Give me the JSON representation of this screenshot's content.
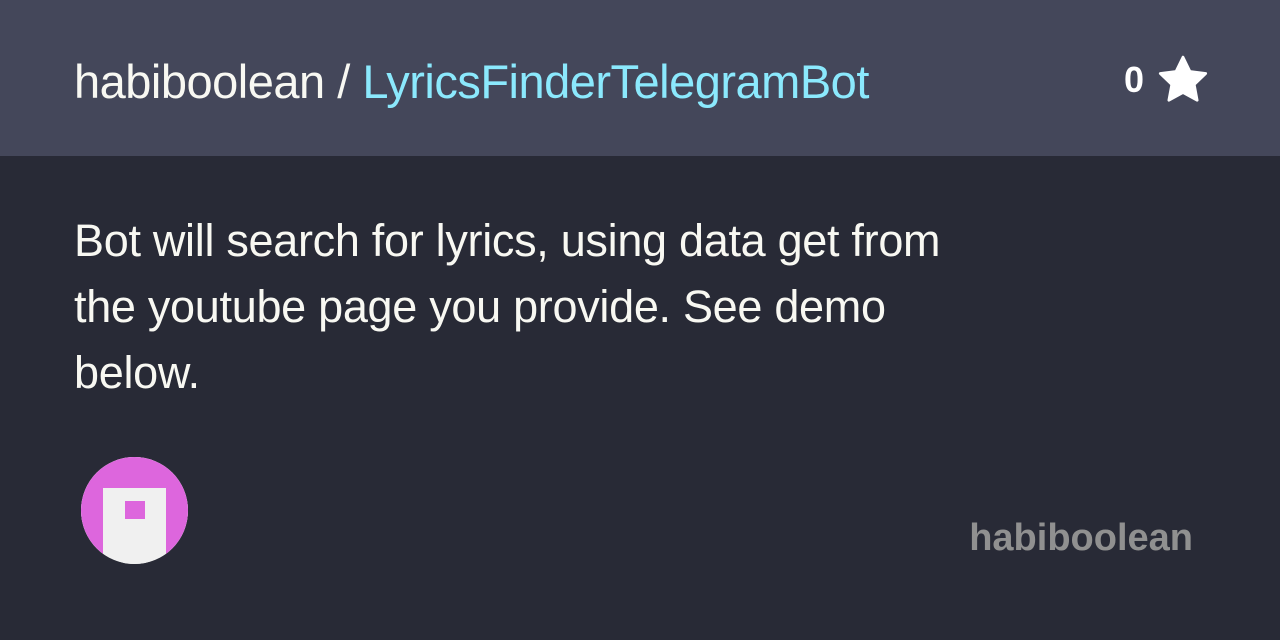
{
  "header": {
    "owner": "habiboolean",
    "separator": " / ",
    "repo": "LyricsFinderTelegramBot",
    "star_count": "0",
    "star_icon": "star-icon"
  },
  "description": "Bot will search for lyrics, using data get from the youtube page you provide. See demo below.",
  "footer": {
    "avatar_icon": "identicon-avatar",
    "author": "habiboolean"
  },
  "colors": {
    "header_bg": "#44475a",
    "body_bg": "#282a36",
    "repo_link": "#8be9fd",
    "avatar_accent": "#dd66dd"
  }
}
